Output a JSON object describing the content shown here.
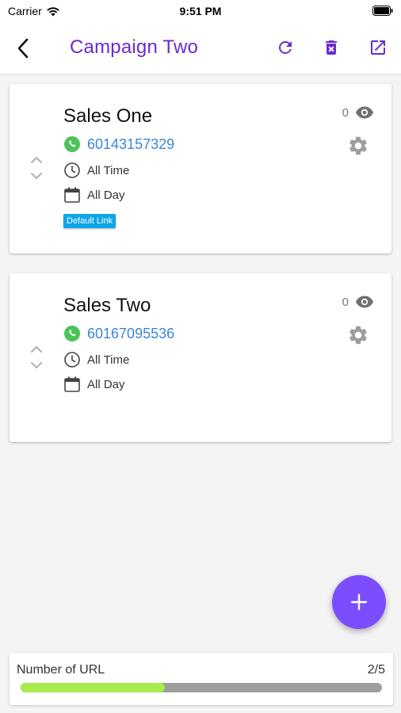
{
  "status_bar": {
    "carrier": "Carrier",
    "time": "9:51 PM"
  },
  "header": {
    "title": "Campaign Two",
    "accent_color": "#6a2bd0"
  },
  "cards": [
    {
      "name": "Sales One",
      "phone": "60143157329",
      "schedule_time": "All Time",
      "schedule_day": "All Day",
      "views": "0",
      "badge": "Default Link"
    },
    {
      "name": "Sales Two",
      "phone": "60167095536",
      "schedule_time": "All Time",
      "schedule_day": "All Day",
      "views": "0"
    }
  ],
  "footer": {
    "label": "Number of URL",
    "count": "2/5",
    "progress_fraction": 0.4
  },
  "icons": [
    "wifi-icon",
    "battery-icon",
    "back-arrow-icon",
    "refresh-icon",
    "delete-icon",
    "open-external-icon",
    "reorder-icon",
    "whatsapp-icon",
    "clock-icon",
    "calendar-icon",
    "eye-icon",
    "gear-icon",
    "plus-icon"
  ]
}
